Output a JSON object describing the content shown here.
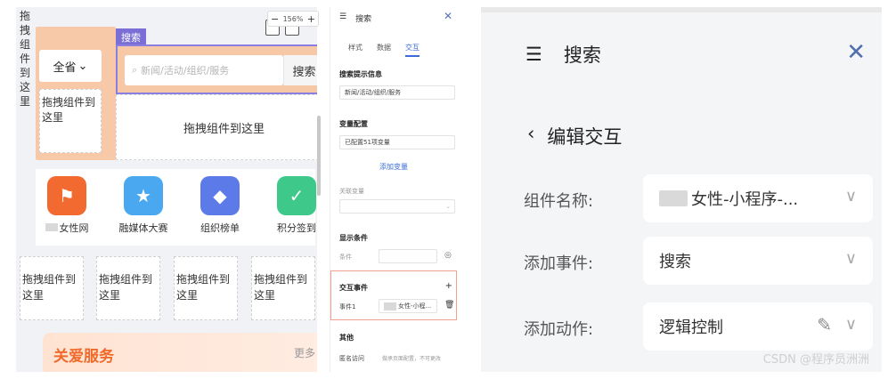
{
  "canvas": {
    "zoom_level": "156%",
    "zoom_minus": "−",
    "zoom_plus": "+",
    "vertical_text": "拖拽组件到这里",
    "province_select": "全省",
    "drop_small": "拖拽组件到这里",
    "search_tag": "搜索",
    "search_placeholder": "新闻/活动/组织/服务",
    "search_button": "搜索",
    "drop_large": "拖拽组件到这里",
    "apps": [
      {
        "label": "女性网",
        "color": "#f26a2f",
        "glyph": "⚑"
      },
      {
        "label": "融媒体大赛",
        "color": "#4aa8f0",
        "glyph": "★"
      },
      {
        "label": "组织榜单",
        "color": "#5c7be8",
        "glyph": "◆"
      },
      {
        "label": "积分签到",
        "color": "#3ec88a",
        "glyph": "✓"
      }
    ],
    "drop_row": [
      "拖拽组件到这里",
      "拖拽组件到这里",
      "拖拽组件到这里",
      "拖拽组件到这里"
    ],
    "care_title": "关爱服务",
    "care_more": "更多"
  },
  "panel": {
    "icon": "☰",
    "title": "搜索",
    "close": "✕",
    "tabs": [
      "样式",
      "数据",
      "交互"
    ],
    "hint_label": "搜索提示信息",
    "hint_value": "新闻/活动/组织/服务",
    "var_label": "变量配置",
    "var_value": "已配置51项变量",
    "add_var": "添加变量",
    "related_var": "关联变量",
    "display_cond": "显示条件",
    "cond_label": "条件",
    "event_label": "交互事件",
    "event_add": "+",
    "event1_label": "事件1",
    "event1_value": "女性-小程...",
    "other_label": "其他",
    "dark_label": "匿名访问",
    "dark_value": "做承页面配置，不可更改"
  },
  "zoom": {
    "icon": "☰",
    "title": "搜索",
    "close": "✕",
    "back": "‹",
    "back_title": "编辑交互",
    "rows": [
      {
        "label": "组件名称:",
        "value": "女性-小程序-..."
      },
      {
        "label": "添加事件:",
        "value": "搜索"
      },
      {
        "label": "添加动作:",
        "value": "逻辑控制"
      }
    ],
    "chevron": "∨",
    "pen": "✎",
    "watermark": "CSDN @程序员洲洲"
  }
}
